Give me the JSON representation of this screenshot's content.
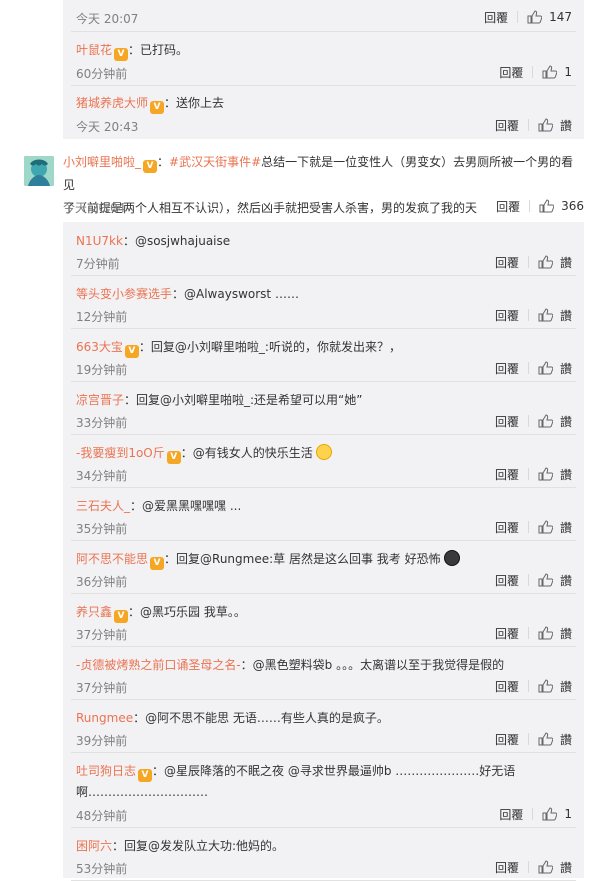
{
  "top_comment": {
    "time": "今天 20:07",
    "reply_label": "回覆",
    "likes": "147"
  },
  "top_replies": [
    {
      "name": "叶鼠花",
      "badge": "V",
      "text": "：已打码。",
      "time": "60分钟前",
      "reply_label": "回覆",
      "likes": "1"
    },
    {
      "name": "猪城养虎大师",
      "badge": "V",
      "text": "：送你上去",
      "time": "今天 20:43",
      "reply_label": "回覆",
      "likes": "讚"
    }
  ],
  "main_comment": {
    "name": "小刘噼里啪啦_",
    "badge": "V",
    "topic": "#武汉天街事件#",
    "text_line1": "总结一下就是一位变性人（男变女）去男厕所被一个男的看见",
    "text_line2": "了（前提是两个人相互不认识），然后凶手就把受害人杀害，男的发疯了我的天",
    "time": "今天 20:04",
    "reply_label": "回覆",
    "likes": "366"
  },
  "replies": [
    {
      "name": "N1U7kk",
      "badge": "",
      "text": "：@sosjwhajuaise",
      "time": "7分钟前",
      "reply_label": "回覆",
      "likes": "讚"
    },
    {
      "name": "等头变小参赛选手",
      "badge": "",
      "text": "：@Alwaysworst ……",
      "time": "12分钟前",
      "reply_label": "回覆",
      "likes": "讚"
    },
    {
      "name": "663大宝",
      "badge": "V",
      "text": "：回复@小刘噼里啪啦_:听说的，你就发出来？，",
      "time": "19分钟前",
      "reply_label": "回覆",
      "likes": "讚"
    },
    {
      "name": "凉宫晋子",
      "badge": "",
      "text": "：回复@小刘噼里啪啦_:还是希望可以用“她”",
      "time": "33分钟前",
      "reply_label": "回覆",
      "likes": "讚"
    },
    {
      "name": "-我要瘦到1oO斤",
      "badge": "V",
      "text": "：@有钱女人的快乐生活",
      "emoji": "yellow",
      "time": "34分钟前",
      "reply_label": "回覆",
      "likes": "讚"
    },
    {
      "name": "三石夫人_",
      "badge": "",
      "text": "：@爱黑黑嘿嘿嘿 ...",
      "time": "35分钟前",
      "reply_label": "回覆",
      "likes": "讚"
    },
    {
      "name": "阿不思不能思",
      "badge": "V",
      "text": "：回复@Rungmee:草 居然是这么回事 我考 好恐怖",
      "emoji": "dark",
      "time": "36分钟前",
      "reply_label": "回覆",
      "likes": "讚"
    },
    {
      "name": "养只鑫",
      "badge": "V",
      "text": "：@黑巧乐园 我草。。",
      "time": "37分钟前",
      "reply_label": "回覆",
      "likes": "讚"
    },
    {
      "name": "-贞德被烤熟之前口诵圣母之名-",
      "badge": "",
      "text": "：@黑色塑料袋b 。。。太离谱以至于我觉得是假的",
      "time": "37分钟前",
      "reply_label": "回覆",
      "likes": "讚"
    },
    {
      "name": "Rungmee",
      "badge": "",
      "text": "：@阿不思不能思 无语……有些人真的是疯子。",
      "time": "39分钟前",
      "reply_label": "回覆",
      "likes": "讚"
    },
    {
      "name": "吐司狗日志",
      "badge": "V",
      "text": "：@星辰降落的不眠之夜 @寻求世界最逼帅b …………………好无语",
      "text2": "啊…………………………",
      "time": "48分钟前",
      "reply_label": "回覆",
      "likes": "1"
    },
    {
      "name": "困阿六",
      "badge": "",
      "text": "：回复@发发队立大功:他妈的。",
      "time": "53分钟前",
      "reply_label": "回覆",
      "likes": "讚"
    }
  ]
}
